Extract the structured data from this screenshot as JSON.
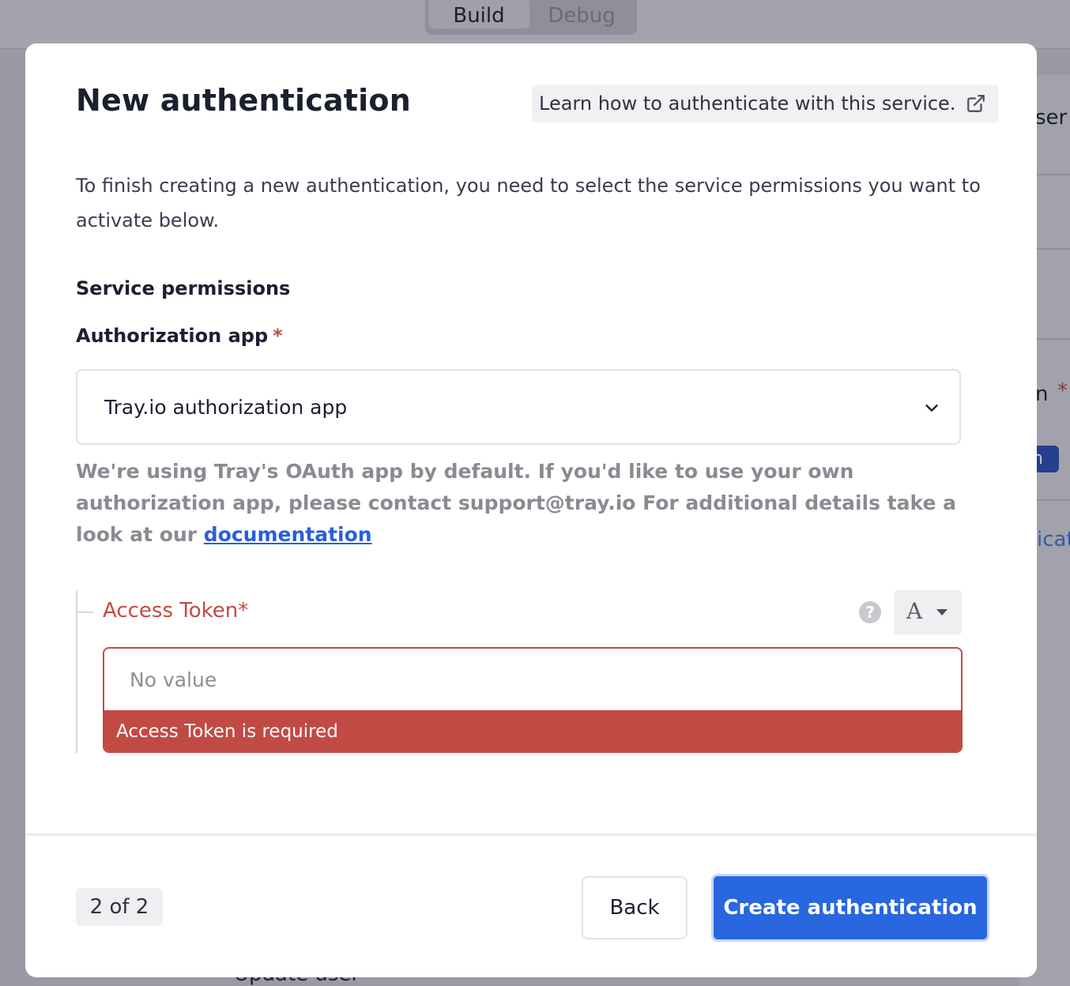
{
  "background": {
    "tabs": [
      {
        "label": "Build",
        "active": true
      },
      {
        "label": "Debug",
        "active": false
      }
    ],
    "side_text_1": "ser",
    "side_text_2": "n",
    "side_star": "*",
    "side_pill": "n",
    "side_link": "icat",
    "bottom_text": "Update user"
  },
  "modal": {
    "title": "New authentication",
    "learn_link": "Learn how to authenticate with this service.",
    "intro": "To finish creating a new authentication, you need to select the service permissions you want to activate below.",
    "section_title": "Service permissions",
    "auth_app": {
      "label": "Authorization app",
      "required_mark": "*",
      "selected": "Tray.io authorization app",
      "help_text": "We're using Tray's OAuth app by default. If you'd like to use your own authorization app, please contact support@tray.io For additional details take a look at our",
      "help_link": "documentation"
    },
    "access_token": {
      "label": "Access Token*",
      "type_glyph": "A",
      "placeholder": "No value",
      "value": "",
      "error": "Access Token is required"
    },
    "footer": {
      "step": "2 of 2",
      "back_label": "Back",
      "create_label": "Create authentication"
    }
  },
  "colors": {
    "primary": "#2867e0",
    "error": "#c24a44",
    "link": "#2a5fd8",
    "overlay": "#9a9aa6"
  },
  "icons": {
    "learn_link": "external-link-icon",
    "select": "chevron-down-icon",
    "help": "question-circle-icon",
    "type": "caret-down-icon"
  }
}
